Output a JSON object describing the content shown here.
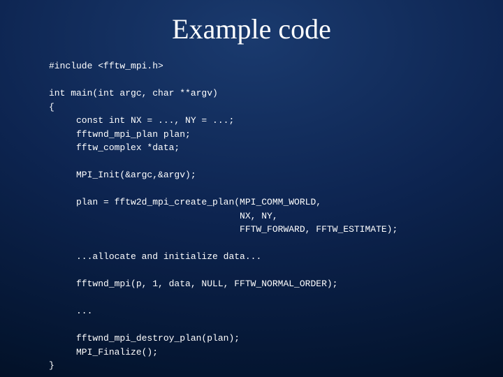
{
  "slide": {
    "title": "Example code",
    "code": "#include <fftw_mpi.h>\n\nint main(int argc, char **argv)\n{\n     const int NX = ..., NY = ...;\n     fftwnd_mpi_plan plan;\n     fftw_complex *data;\n\n     MPI_Init(&argc,&argv);\n\n     plan = fftw2d_mpi_create_plan(MPI_COMM_WORLD,\n                                   NX, NY,\n                                   FFTW_FORWARD, FFTW_ESTIMATE);\n\n     ...allocate and initialize data...\n\n     fftwnd_mpi(p, 1, data, NULL, FFTW_NORMAL_ORDER);\n\n     ...\n\n     fftwnd_mpi_destroy_plan(plan);\n     MPI_Finalize();\n}"
  }
}
